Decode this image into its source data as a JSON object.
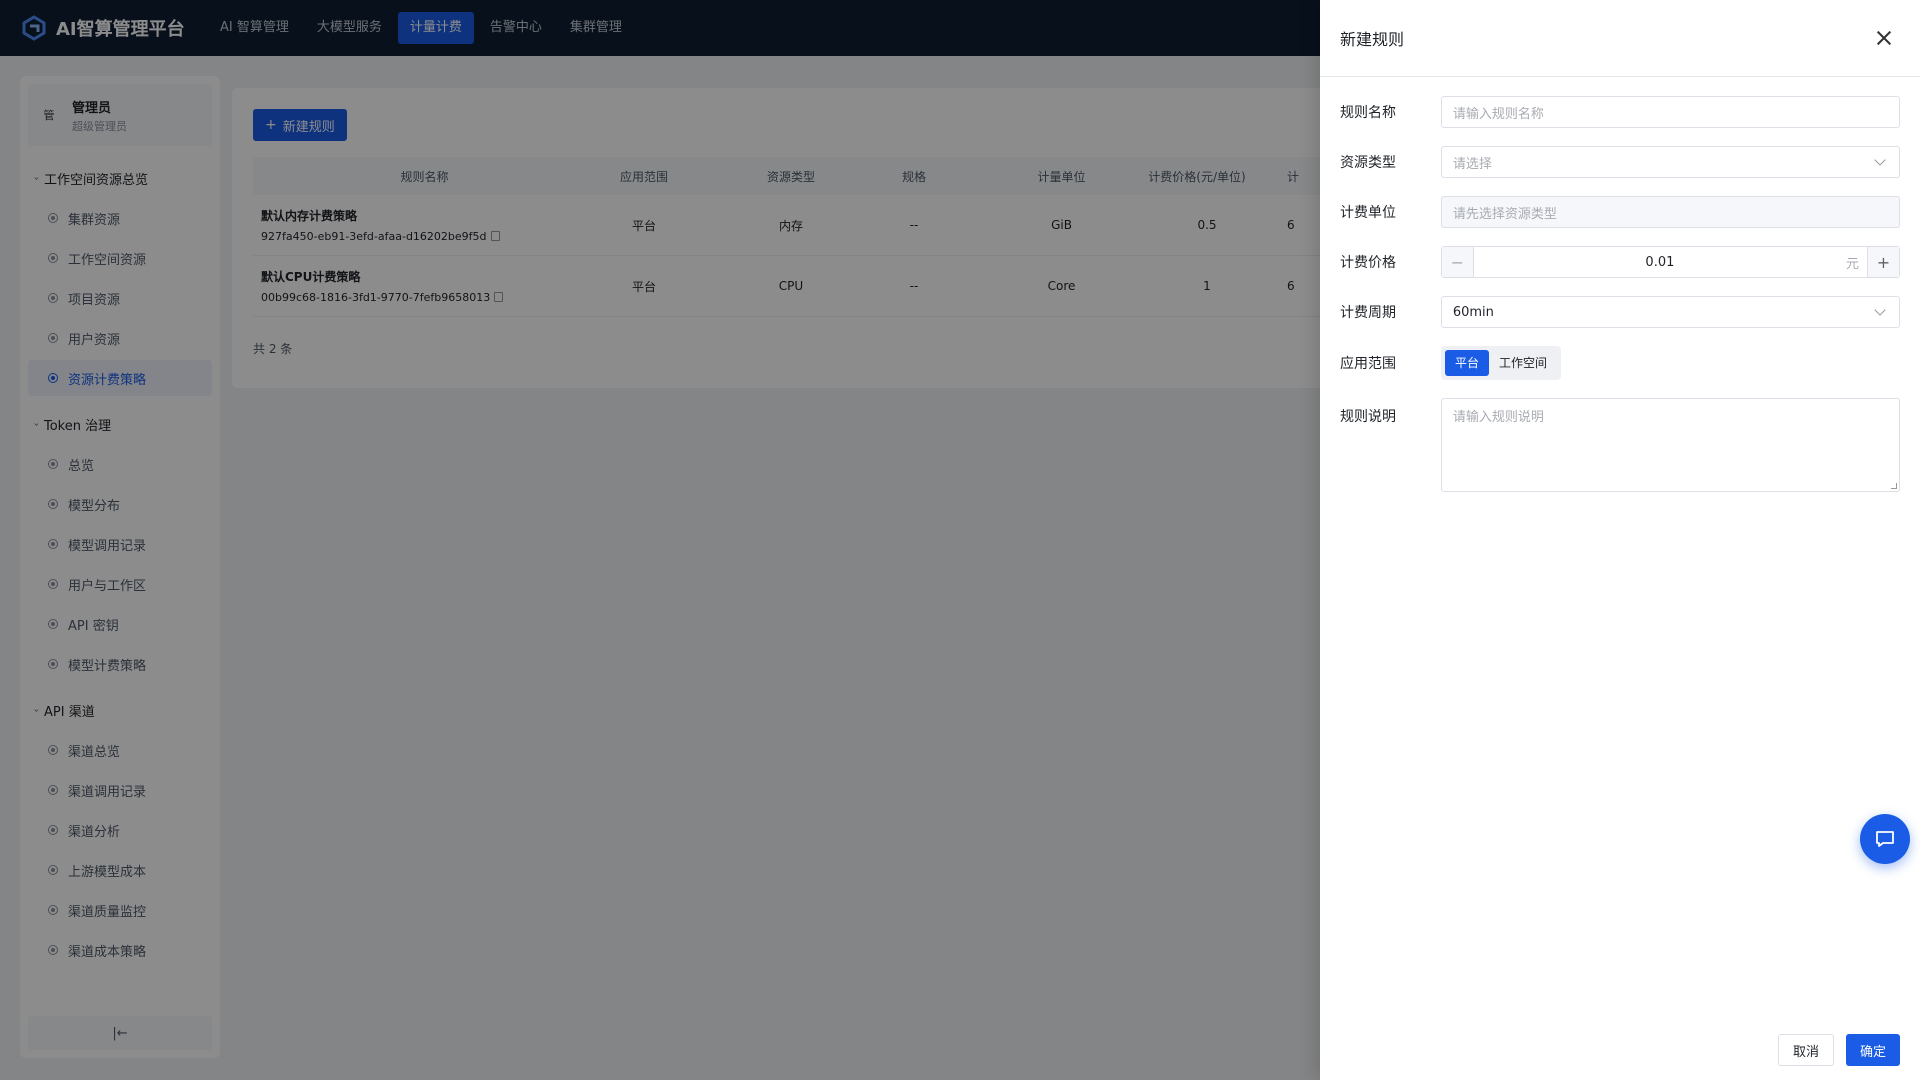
{
  "header": {
    "app_title": "AI智算管理平台",
    "nav": [
      {
        "label": "AI 智算管理",
        "active": false
      },
      {
        "label": "大模型服务",
        "active": false
      },
      {
        "label": "计量计费",
        "active": true
      },
      {
        "label": "告警中心",
        "active": false
      },
      {
        "label": "集群管理",
        "active": false
      }
    ]
  },
  "user": {
    "avatar_text": "管",
    "name": "管理员",
    "role": "超级管理员"
  },
  "sidebar": {
    "groups": [
      {
        "title": "工作空间资源总览",
        "items": [
          {
            "label": "集群资源",
            "icon": "circle-dot-icon",
            "active": false
          },
          {
            "label": "工作空间资源",
            "icon": "circle-dot-icon",
            "active": false
          },
          {
            "label": "项目资源",
            "icon": "circle-dot-icon",
            "active": false
          },
          {
            "label": "用户资源",
            "icon": "circle-dot-icon",
            "active": false
          },
          {
            "label": "资源计费策略",
            "icon": "circle-dot-icon",
            "active": true
          }
        ]
      },
      {
        "title": "Token 治理",
        "items": [
          {
            "label": "总览",
            "icon": "circle-dot-icon",
            "active": false
          },
          {
            "label": "模型分布",
            "icon": "circle-dot-icon",
            "active": false
          },
          {
            "label": "模型调用记录",
            "icon": "circle-dot-icon",
            "active": false
          },
          {
            "label": "用户与工作区",
            "icon": "circle-dot-icon",
            "active": false
          },
          {
            "label": "API 密钥",
            "icon": "circle-dot-icon",
            "active": false
          },
          {
            "label": "模型计费策略",
            "icon": "circle-dot-icon",
            "active": false
          }
        ]
      },
      {
        "title": "API 渠道",
        "items": [
          {
            "label": "渠道总览",
            "icon": "circle-dot-icon",
            "active": false
          },
          {
            "label": "渠道调用记录",
            "icon": "circle-dot-icon",
            "active": false
          },
          {
            "label": "渠道分析",
            "icon": "circle-dot-icon",
            "active": false
          },
          {
            "label": "上游模型成本",
            "icon": "circle-dot-icon",
            "active": false
          },
          {
            "label": "渠道质量监控",
            "icon": "circle-dot-icon",
            "active": false
          },
          {
            "label": "渠道成本策略",
            "icon": "circle-dot-icon",
            "active": false
          }
        ]
      }
    ],
    "collapse_label": "|←"
  },
  "main": {
    "new_button": "新建规则",
    "columns": [
      "规则名称",
      "应用范围",
      "资源类型",
      "规格",
      "计量单位",
      "计费价格(元/单位)",
      "计"
    ],
    "rows": [
      {
        "name": "默认内存计费策略",
        "id": "927fa450-eb91-3efd-afaa-d16202be9f5d",
        "scope": "平台",
        "type": "内存",
        "spec": "--",
        "unit": "GiB",
        "price": "0.5",
        "more": "6"
      },
      {
        "name": "默认CPU计费策略",
        "id": "00b99c68-1816-3fd1-9770-7fefb9658013",
        "scope": "平台",
        "type": "CPU",
        "spec": "--",
        "unit": "Core",
        "price": "1",
        "more": "6"
      }
    ],
    "total": "共 2 条"
  },
  "drawer": {
    "title": "新建规则",
    "fields": {
      "name": {
        "label": "规则名称",
        "placeholder": "请输入规则名称"
      },
      "type": {
        "label": "资源类型",
        "placeholder": "请选择"
      },
      "unit": {
        "label": "计费单位",
        "placeholder": "请先选择资源类型"
      },
      "price": {
        "label": "计费价格",
        "value": "0.01",
        "suffix": "元",
        "minus": "−",
        "plus": "+"
      },
      "period": {
        "label": "计费周期",
        "value": "60min"
      },
      "scope": {
        "label": "应用范围",
        "options": [
          "平台",
          "工作空间"
        ],
        "selected": "平台"
      },
      "desc": {
        "label": "规则说明",
        "placeholder": "请输入规则说明"
      }
    },
    "cancel": "取消",
    "confirm": "确定"
  },
  "colors": {
    "primary": "#1a5ce5",
    "header_bg": "#0f1e33"
  }
}
